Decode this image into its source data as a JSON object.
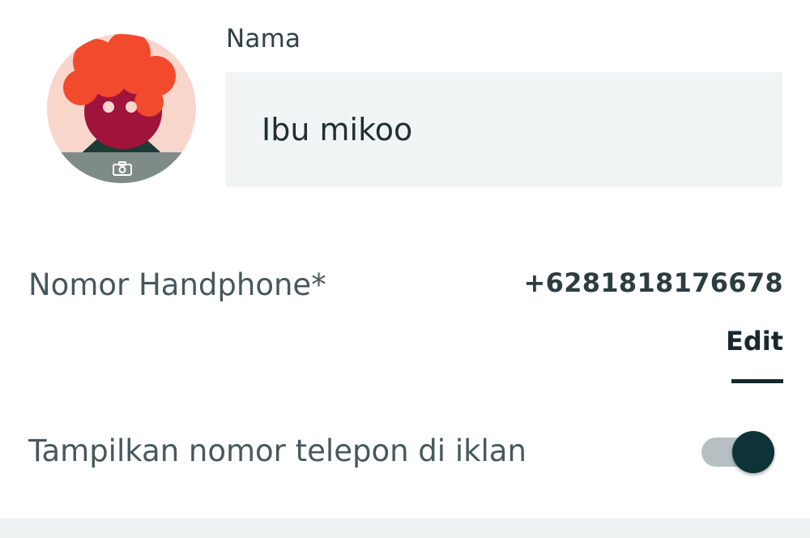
{
  "profile": {
    "avatar_icon": "avatar-illustration",
    "camera_icon": "camera-icon"
  },
  "name_field": {
    "label": "Nama",
    "value": "Ibu mikoo"
  },
  "phone": {
    "label": "Nomor Handphone*",
    "value": "+6281818176678",
    "edit_label": "Edit"
  },
  "show_phone": {
    "label": "Tampilkan nomor telepon di iklan",
    "enabled": true
  },
  "colors": {
    "accent": "#0d3237",
    "avatar_hair": "#f24a2c",
    "avatar_face": "#a0143c",
    "avatar_bg": "#f9d6cc",
    "input_bg": "#f1f4f5"
  }
}
